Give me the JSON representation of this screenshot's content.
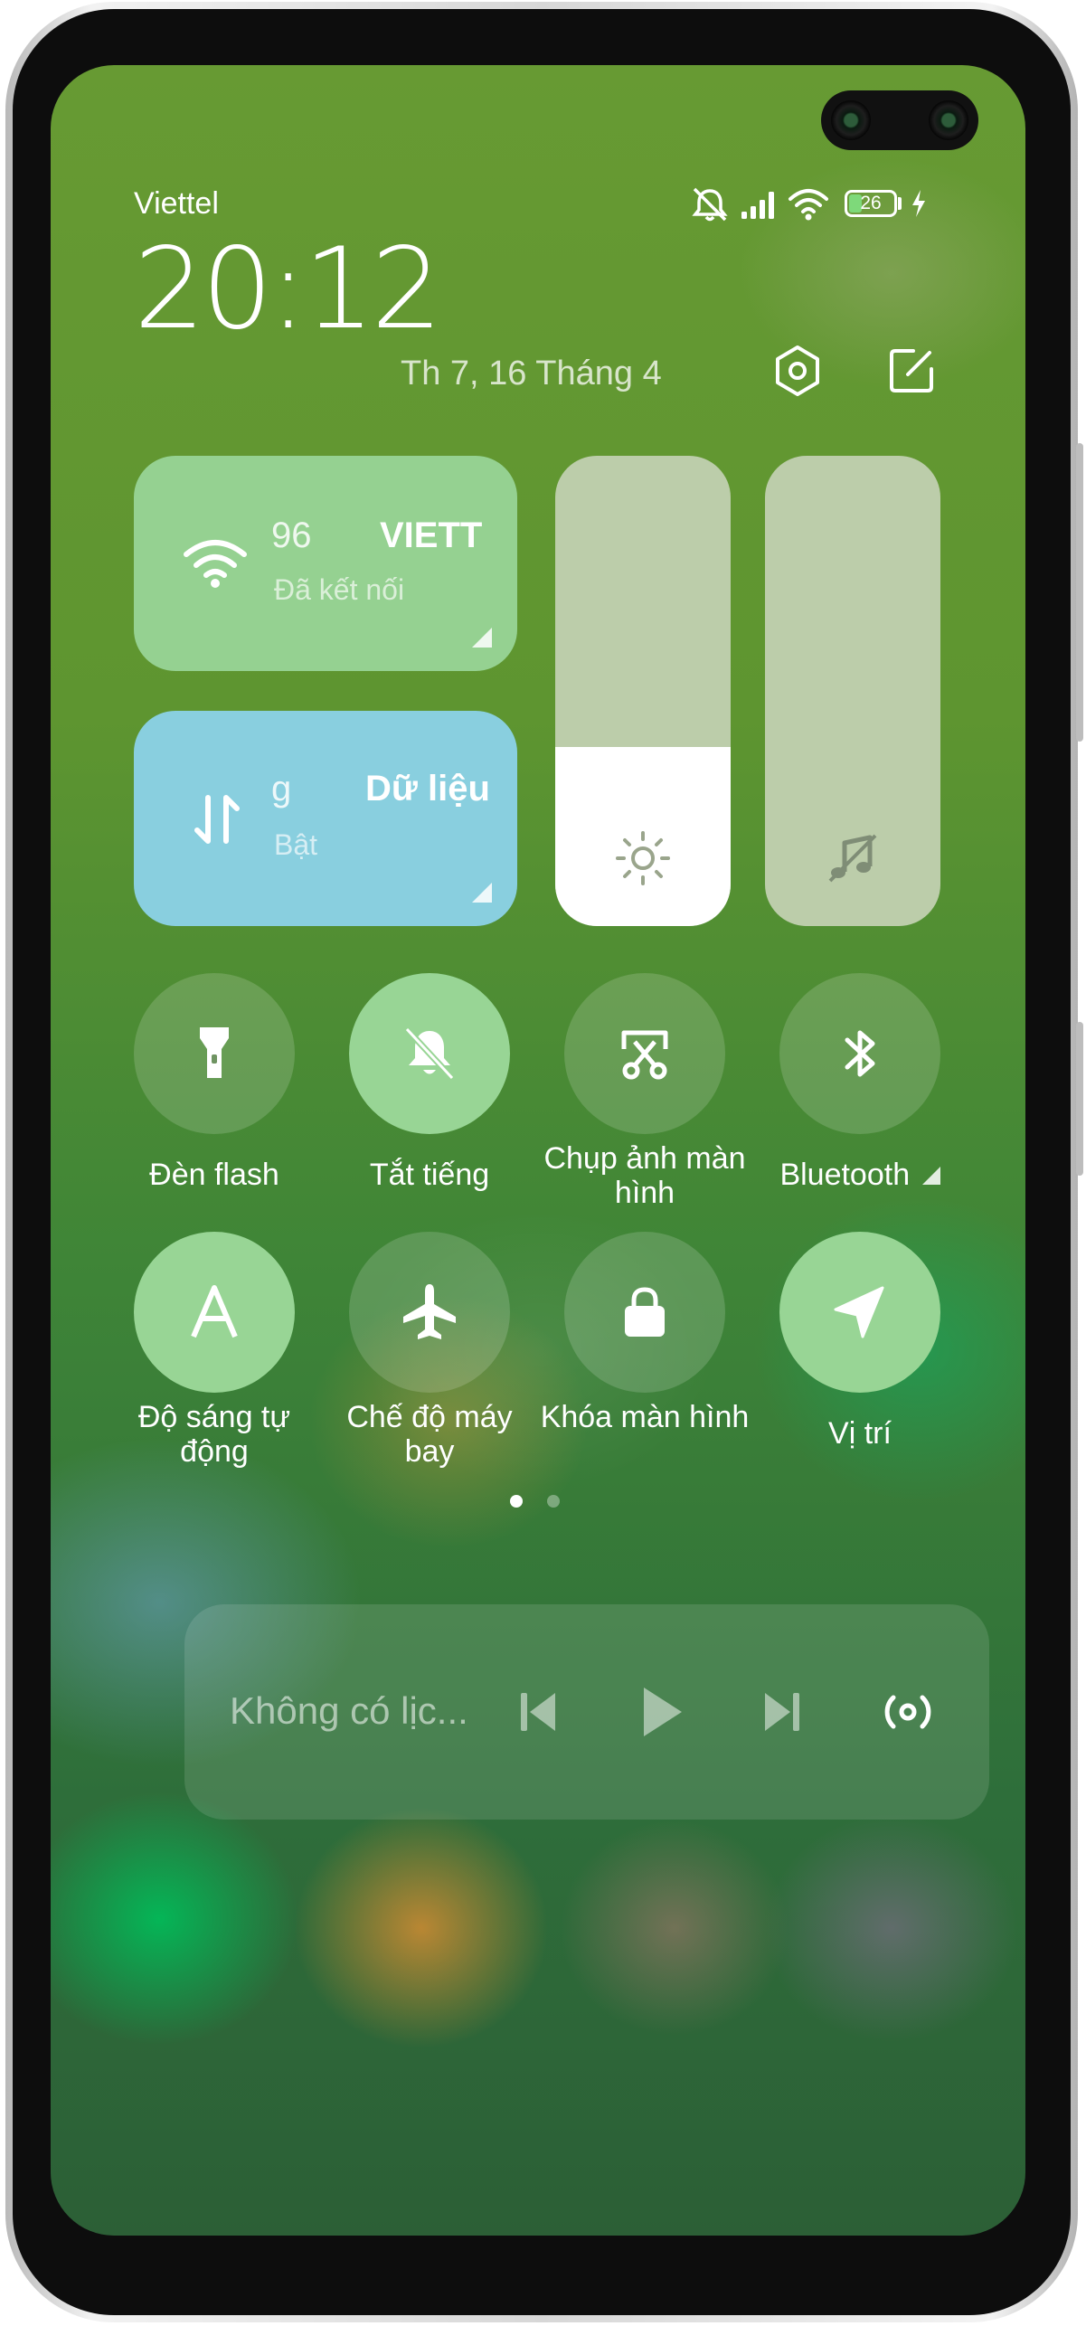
{
  "status_bar": {
    "carrier": "Viettel",
    "battery": "26",
    "icons": [
      "mute-icon",
      "signal-icon",
      "wifi-icon",
      "battery-icon",
      "charging-icon"
    ]
  },
  "header": {
    "time": "20:12",
    "date": "Th 7, 16 Tháng 4",
    "settings_icon": "gear-icon",
    "edit_icon": "edit-icon"
  },
  "tiles": {
    "wifi": {
      "title": "VIETT",
      "title_scroll": "96",
      "subtitle": "Đã kết nối",
      "icon": "wifi-icon"
    },
    "data": {
      "title": "Dữ liệu",
      "title_scroll": "g",
      "subtitle": "Bật",
      "icon": "data-transfer-icon"
    }
  },
  "sliders": {
    "brightness": {
      "level": 0.38,
      "icon": "sun-icon"
    },
    "volume": {
      "level": 0,
      "icon": "music-note-icon"
    }
  },
  "toggles": [
    {
      "label": "Đèn flash",
      "icon": "flashlight-icon",
      "active": false
    },
    {
      "label": "Tắt tiếng",
      "icon": "mute-bell-icon",
      "active": true
    },
    {
      "label": "Chụp ảnh màn hình",
      "icon": "screenshot-icon",
      "active": false
    },
    {
      "label": "Bluetooth",
      "icon": "bluetooth-icon",
      "active": false
    },
    {
      "label": "Độ sáng tự động",
      "icon": "auto-brightness-icon",
      "active": true
    },
    {
      "label": "Chế độ máy bay",
      "icon": "airplane-icon",
      "active": false
    },
    {
      "label": "Khóa màn hình",
      "icon": "lock-icon",
      "active": false
    },
    {
      "label": "Vị trí",
      "icon": "location-icon",
      "active": true
    }
  ],
  "pager": {
    "current": 1,
    "total": 2
  },
  "media": {
    "text": "Không có lịc...",
    "controls": [
      "previous-icon",
      "play-icon",
      "next-icon",
      "cast-icon"
    ]
  },
  "colors": {
    "active_green": "#98d595",
    "wifi_tile": "#95d191",
    "data_tile": "#89cfdf"
  }
}
